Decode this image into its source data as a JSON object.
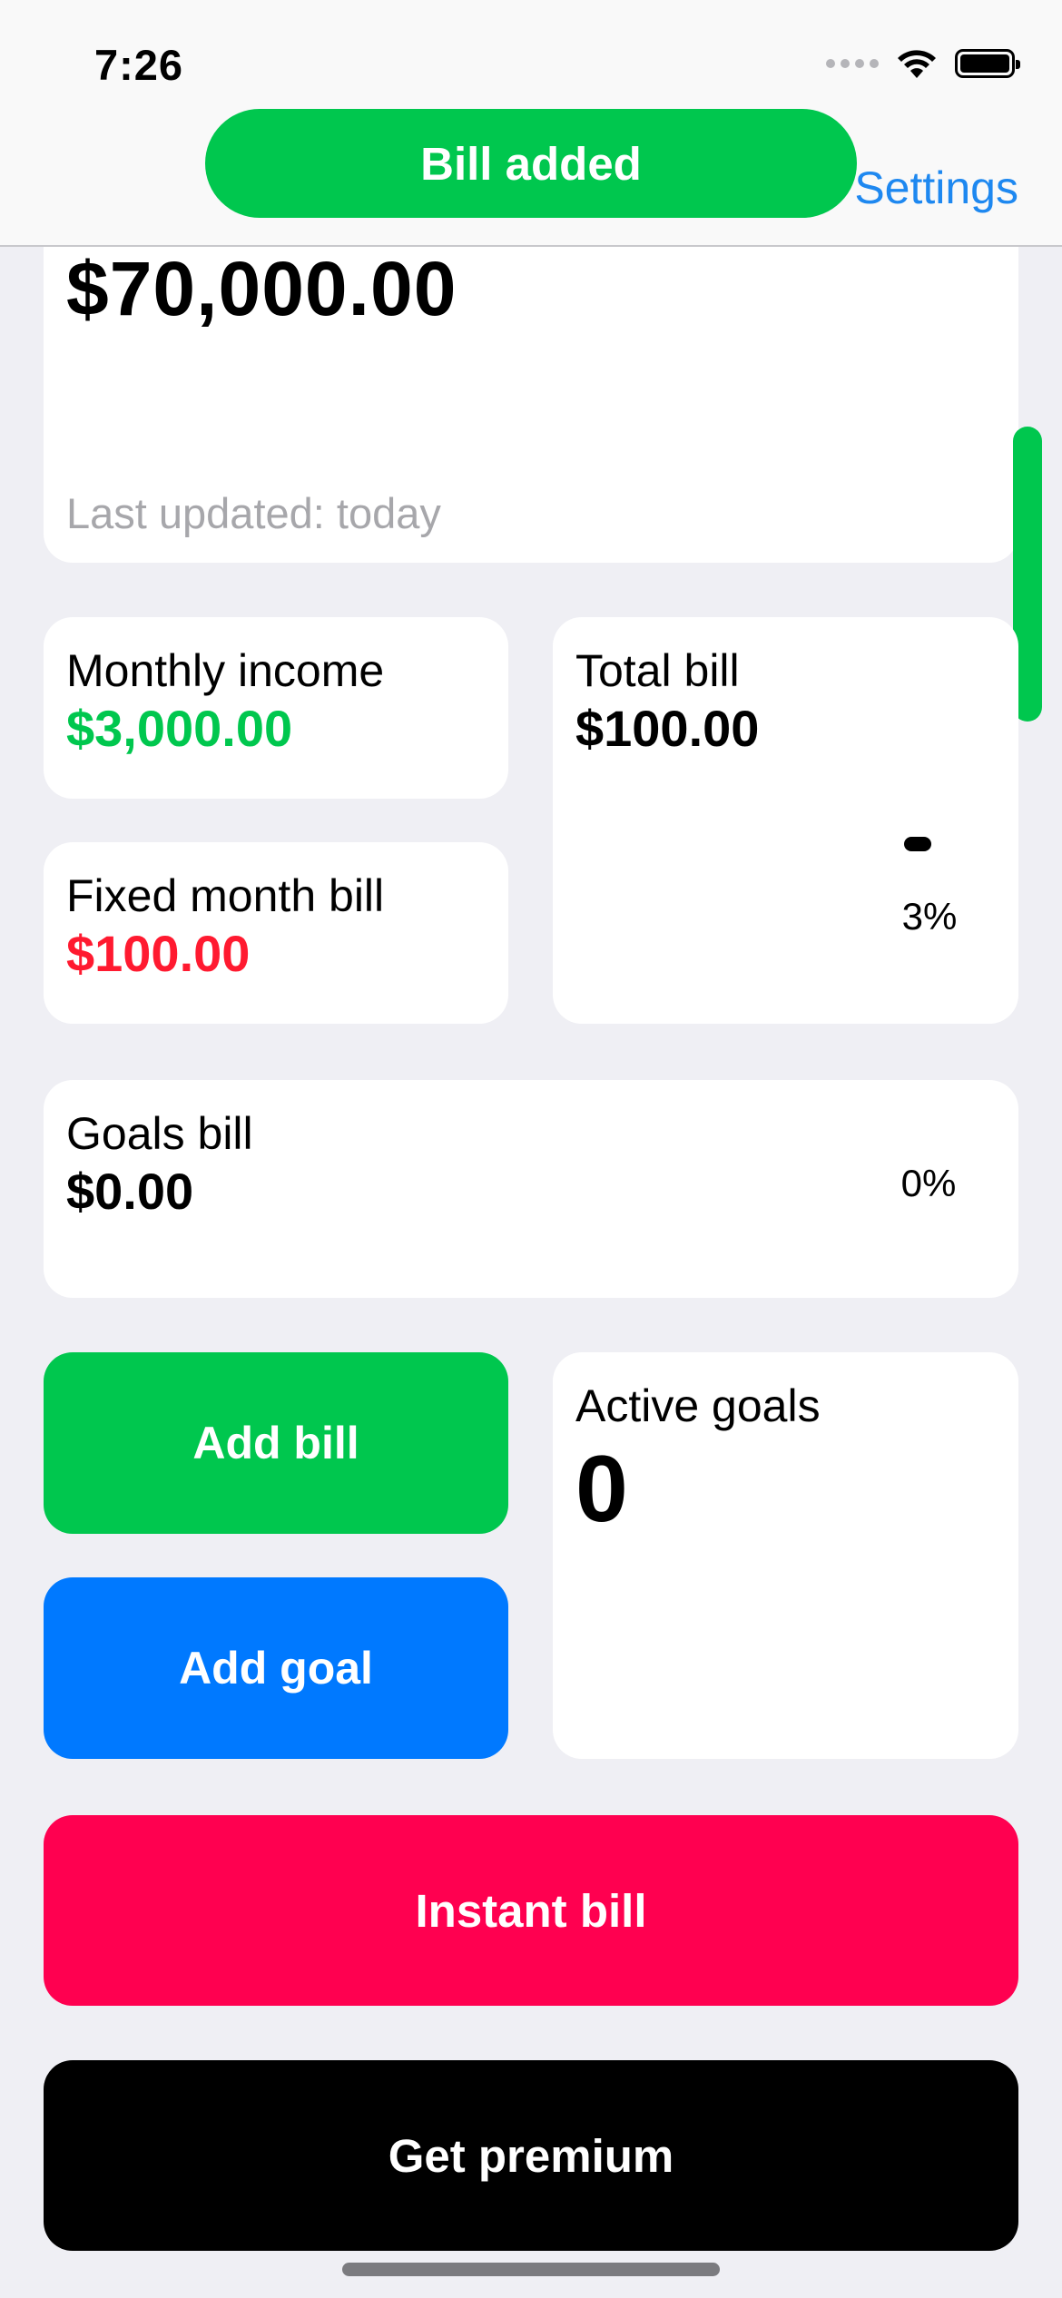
{
  "status_bar": {
    "time": "7:26",
    "icons": [
      "signal-icon",
      "wifi-icon",
      "battery-icon"
    ]
  },
  "nav": {
    "settings_label": "Settings"
  },
  "toast": {
    "message": "Bill added",
    "color": "#00C74E"
  },
  "balance": {
    "amount": "$70,000.00",
    "last_updated": "Last updated: today"
  },
  "income": {
    "label": "Monthly income",
    "value": "$3,000.00"
  },
  "fixed_bill": {
    "label": "Fixed month bill",
    "value": "$100.00"
  },
  "total_bill": {
    "label": "Total bill",
    "value": "$100.00",
    "percent": "3%"
  },
  "goals_bill": {
    "label": "Goals bill",
    "value": "$0.00",
    "percent": "0%"
  },
  "active_goals": {
    "label": "Active goals",
    "value": "0"
  },
  "actions": {
    "add_bill": "Add bill",
    "add_goal": "Add goal",
    "instant_bill": "Instant bill",
    "get_premium": "Get premium"
  },
  "colors": {
    "green": "#00C74E",
    "red": "#FF1A30",
    "blue": "#0079FF",
    "pink": "#FF0050",
    "link": "#1E88F0"
  }
}
